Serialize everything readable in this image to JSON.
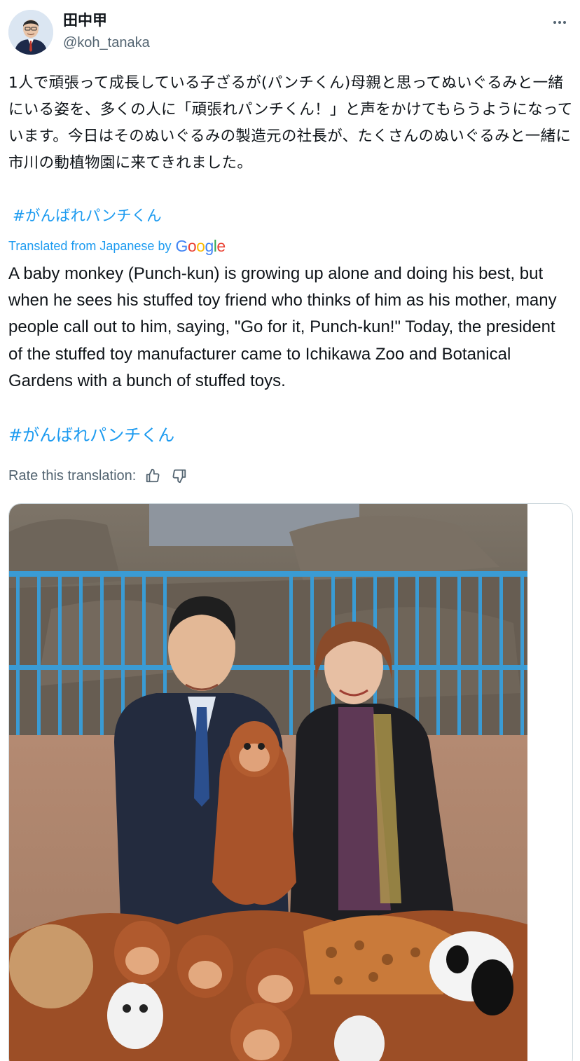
{
  "author": {
    "display_name": "田中甲",
    "handle": "@koh_tanaka"
  },
  "post": {
    "text_jp": "1人で頑張って成長している子ざるが(パンチくん)母親と思ってぬいぐるみと一緒にいる姿を、多くの人に「頑張れパンチくん！」と声をかけてもらうようになっています。今日はそのぬいぐるみの製造元の社長が、たくさんのぬいぐるみと一緒に市川の動植物園に来てきれました。",
    "hashtag": "#がんばれパンチくん",
    "translated_from": "Translated from Japanese by",
    "translator": "Google",
    "translation_text": "A baby monkey (Punch-kun) is growing up alone and doing his best, but when he sees his stuffed toy friend who thinks of him as his mother, many people call out to him, saying, \"Go for it, Punch-kun!\" Today, the president of the stuffed toy manufacturer came to Ichikawa Zoo and Botanical Gardens with a bunch of stuffed toys.",
    "translation_hashtag": "#がんばれパンチくん",
    "rate_label": "Rate this translation:"
  },
  "icons": {
    "more": "more-horizontal-icon",
    "thumbs_up": "thumbs-up-icon",
    "thumbs_down": "thumbs-down-icon"
  },
  "colors": {
    "link": "#1d9bf0",
    "text": "#0f1419",
    "secondary": "#536471",
    "google_blue": "#4285F4",
    "google_red": "#EA4335",
    "google_yellow": "#FBBC05",
    "google_green": "#34A853"
  }
}
